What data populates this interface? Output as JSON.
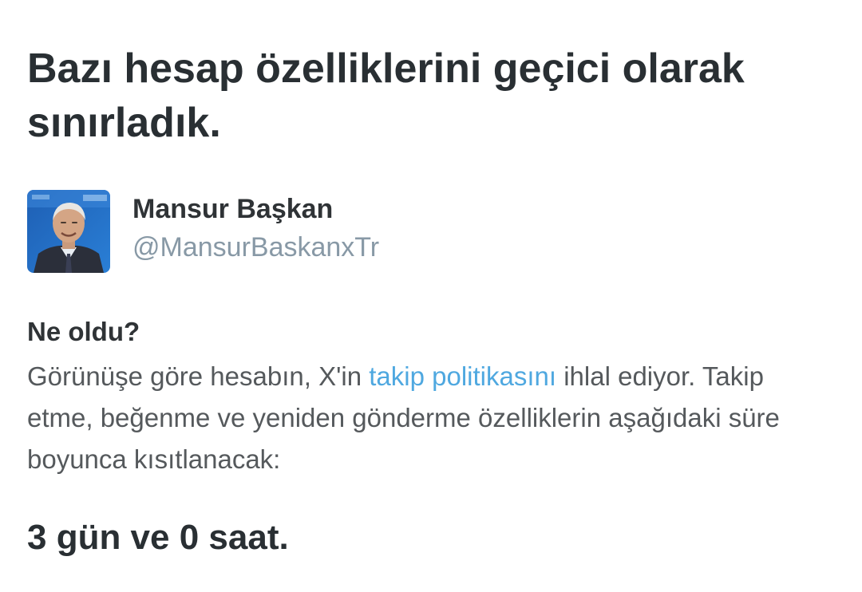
{
  "notice": {
    "title": "Bazı hesap özelliklerini geçici olarak sınırladık."
  },
  "account": {
    "display_name": "Mansur Başkan",
    "handle": "@MansurBaskanxTr",
    "avatar_icon": "profile-photo"
  },
  "details": {
    "heading": "Ne oldu?",
    "text_before_link": "Görünüşe göre hesabın, X'in ",
    "link_label": "takip politikasını",
    "text_after_link": " ihlal ediyor. Takip etme, beğenme ve yeniden gönderme özelliklerin aşağıdaki süre boyunca kısıtlanacak:"
  },
  "restriction": {
    "duration": "3 gün ve 0 saat."
  },
  "colors": {
    "text_primary": "#292f33",
    "text_secondary": "#55595c",
    "handle": "#8899a6",
    "link": "#4fa8e0",
    "background": "#ffffff"
  }
}
